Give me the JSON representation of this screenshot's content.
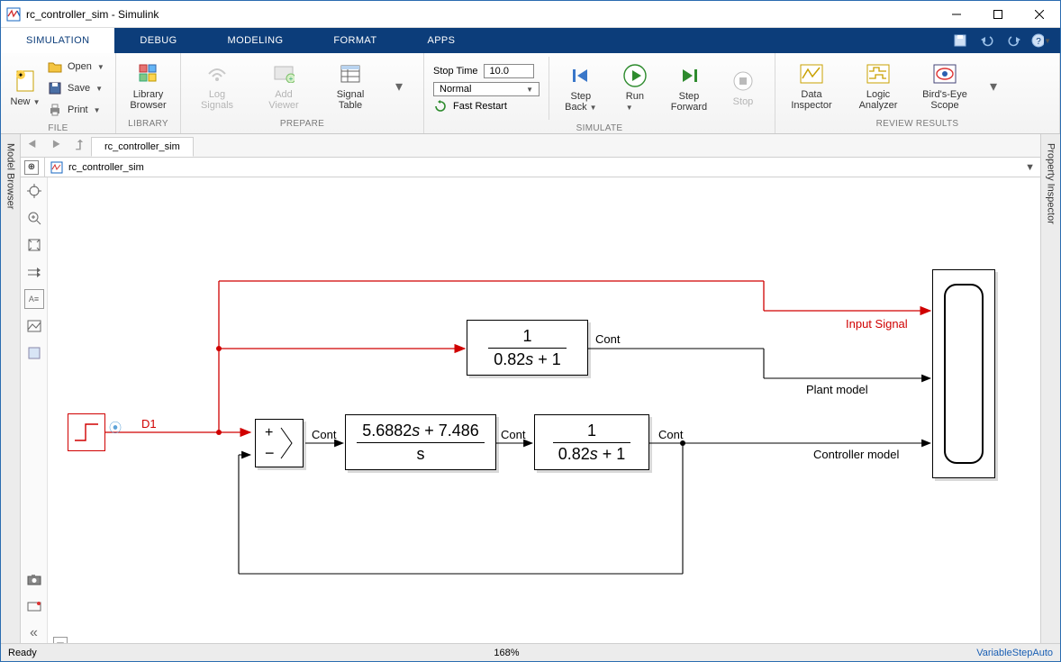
{
  "window": {
    "title": "rc_controller_sim - Simulink"
  },
  "tabs": {
    "simulation": "SIMULATION",
    "debug": "DEBUG",
    "modeling": "MODELING",
    "format": "FORMAT",
    "apps": "APPS"
  },
  "ribbon": {
    "file": {
      "new": "New",
      "open": "Open",
      "save": "Save",
      "print": "Print",
      "group": "FILE"
    },
    "library": {
      "btn": "Library\nBrowser",
      "group": "LIBRARY"
    },
    "prepare": {
      "log": "Log\nSignals",
      "viewer": "Add\nViewer",
      "table": "Signal\nTable",
      "group": "PREPARE"
    },
    "simulate": {
      "stoptime_label": "Stop Time",
      "stoptime_value": "10.0",
      "mode": "Normal",
      "fastrestart": "Fast Restart",
      "stepback": "Step\nBack",
      "run": "Run",
      "stepfwd": "Step\nForward",
      "stop": "Stop",
      "group": "SIMULATE"
    },
    "review": {
      "di": "Data\nInspector",
      "la": "Logic\nAnalyzer",
      "be": "Bird's-Eye\nScope",
      "group": "REVIEW RESULTS"
    }
  },
  "doc": {
    "tab": "rc_controller_sim",
    "crumb": "rc_controller_sim"
  },
  "docks": {
    "left": "Model Browser",
    "right": "Property Inspector"
  },
  "canvas": {
    "d1": "D1",
    "cont1": "Cont",
    "cont2": "Cont",
    "cont3": "Cont",
    "cont4": "Cont",
    "input_signal": "Input Signal",
    "plant_model": "Plant model",
    "controller_model": "Controller model",
    "tf1_num": "1",
    "tf1_den_a": "0.82",
    "tf1_den_b": " + 1",
    "pi_num_a": "5.6882",
    "pi_num_b": " + 7.486",
    "pi_den": "s",
    "tf2_num": "1",
    "tf2_den_a": "0.82",
    "tf2_den_b": " + 1"
  },
  "status": {
    "ready": "Ready",
    "zoom": "168%",
    "solver": "VariableStepAuto"
  }
}
